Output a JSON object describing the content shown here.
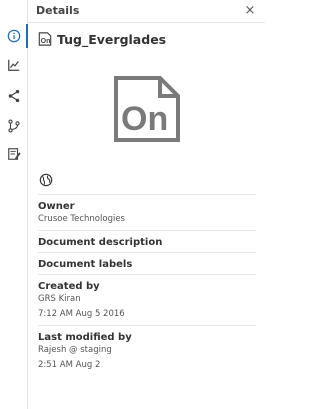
{
  "panel": {
    "title": "Details",
    "close_label": "×"
  },
  "rail": {
    "items": [
      {
        "name": "info-icon",
        "active": true
      },
      {
        "name": "chart-icon",
        "active": false
      },
      {
        "name": "share-icon",
        "active": false
      },
      {
        "name": "branch-icon",
        "active": false
      },
      {
        "name": "notes-icon",
        "active": false
      }
    ],
    "accent": "#1a6dc6"
  },
  "document": {
    "name": "Tug_Everglades",
    "icon_text": "On"
  },
  "owner": {
    "label": "Owner",
    "value": "Crusoe Technologies"
  },
  "description": {
    "label": "Document description"
  },
  "labels": {
    "label": "Document labels"
  },
  "created": {
    "label": "Created by",
    "by": "GRS Kiran",
    "when": "7:12 AM Aug 5 2016"
  },
  "modified": {
    "label": "Last modified by",
    "by": "Rajesh @ staging",
    "when": "2:51 AM Aug 2"
  }
}
